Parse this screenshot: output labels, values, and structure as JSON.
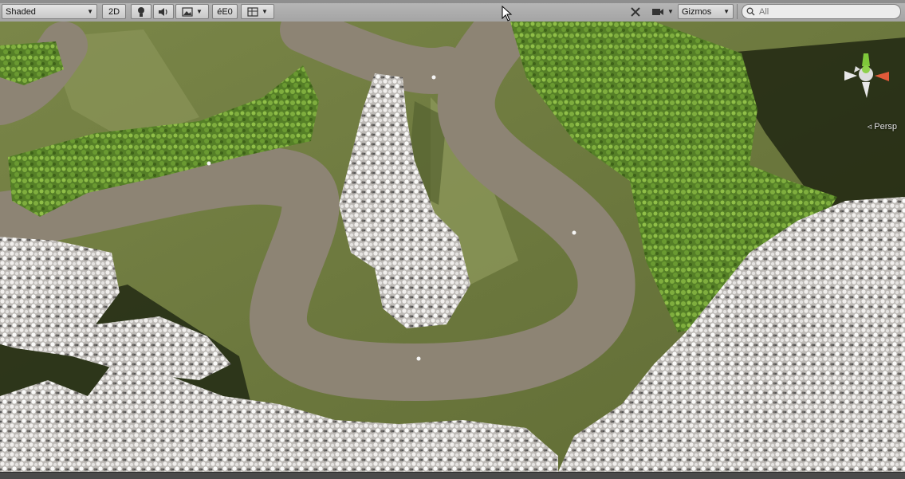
{
  "toolbar": {
    "shading_mode": "Shaded",
    "view_2d_label": "2D",
    "fx_label": "éE0",
    "gizmos_label": "Gizmos",
    "search_placeholder": "All"
  },
  "scene": {
    "camera_label": "◃ Persp"
  },
  "colors": {
    "terrain": "#6f7a3f",
    "path": "#8e8474",
    "foliage_green": "#5a8a2c",
    "foliage_white": "#d8d6d4",
    "shadow": "#1e2612"
  }
}
